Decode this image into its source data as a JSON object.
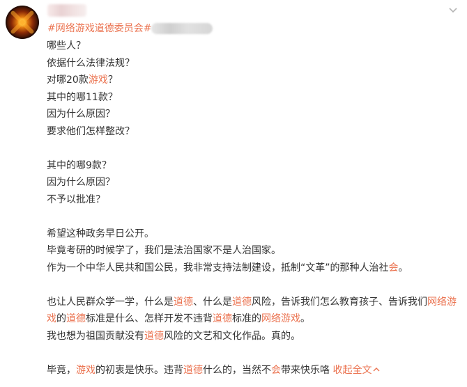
{
  "post": {
    "topic": "网络游戏道德委员会",
    "topic_hash": "#",
    "collapse_label": "收起全文",
    "collapse_icon": "chevron-up-icon"
  },
  "paragraphs": [
    {
      "segments": [
        {
          "t": "哪些人？"
        }
      ]
    },
    {
      "segments": [
        {
          "t": "依据什么法律法规？"
        }
      ]
    },
    {
      "segments": [
        {
          "t": "对哪20款"
        },
        {
          "t": "游戏",
          "kw": true
        },
        {
          "t": "？"
        }
      ]
    },
    {
      "segments": [
        {
          "t": "其中的哪11款？"
        }
      ]
    },
    {
      "segments": [
        {
          "t": "因为什么原因？"
        }
      ]
    },
    {
      "segments": [
        {
          "t": "要求他们怎样整改？"
        }
      ]
    },
    {
      "gap": true
    },
    {
      "segments": [
        {
          "t": "其中的哪9款？"
        }
      ]
    },
    {
      "segments": [
        {
          "t": "因为什么原因？"
        }
      ]
    },
    {
      "segments": [
        {
          "t": "不予以批准？"
        }
      ]
    },
    {
      "gap": true
    },
    {
      "segments": [
        {
          "t": "希望这种政务早日公开。"
        }
      ]
    },
    {
      "segments": [
        {
          "t": "毕竟考研的时候学了，我们是法治国家不是人治国家。"
        }
      ]
    },
    {
      "segments": [
        {
          "t": "作为一个中华人民共和国公民，我非常支持法制建设，抵制“文革”的那种人治社"
        },
        {
          "t": "会",
          "kw": true
        },
        {
          "t": "。"
        }
      ]
    },
    {
      "gap": true
    },
    {
      "segments": [
        {
          "t": "也让人民群众学一学，什么是"
        },
        {
          "t": "道德",
          "kw": true
        },
        {
          "t": "、什么是"
        },
        {
          "t": "道德",
          "kw": true
        },
        {
          "t": "风险，告诉我们怎么教育孩子、告诉我们"
        },
        {
          "t": "网络游",
          "kw": true
        }
      ]
    },
    {
      "segments": [
        {
          "t": "戏",
          "kw": true
        },
        {
          "t": "的"
        },
        {
          "t": "道德",
          "kw": true
        },
        {
          "t": "标准是什么、怎样开发不违背"
        },
        {
          "t": "道德",
          "kw": true
        },
        {
          "t": "标准的"
        },
        {
          "t": "网络游戏",
          "kw": true
        },
        {
          "t": "。"
        }
      ]
    },
    {
      "segments": [
        {
          "t": "我也想为祖国贡献没有"
        },
        {
          "t": "道德",
          "kw": true
        },
        {
          "t": "风险的文艺和文化作品。真的。"
        }
      ]
    },
    {
      "gap": true
    },
    {
      "segments": [
        {
          "t": "毕竟，"
        },
        {
          "t": "游戏",
          "kw": true
        },
        {
          "t": "的初衷是快乐。违背"
        },
        {
          "t": "道德",
          "kw": true
        },
        {
          "t": "什么的，当然不"
        },
        {
          "t": "会",
          "kw": true
        },
        {
          "t": "带来快乐咯 "
        }
      ],
      "more": true
    }
  ]
}
